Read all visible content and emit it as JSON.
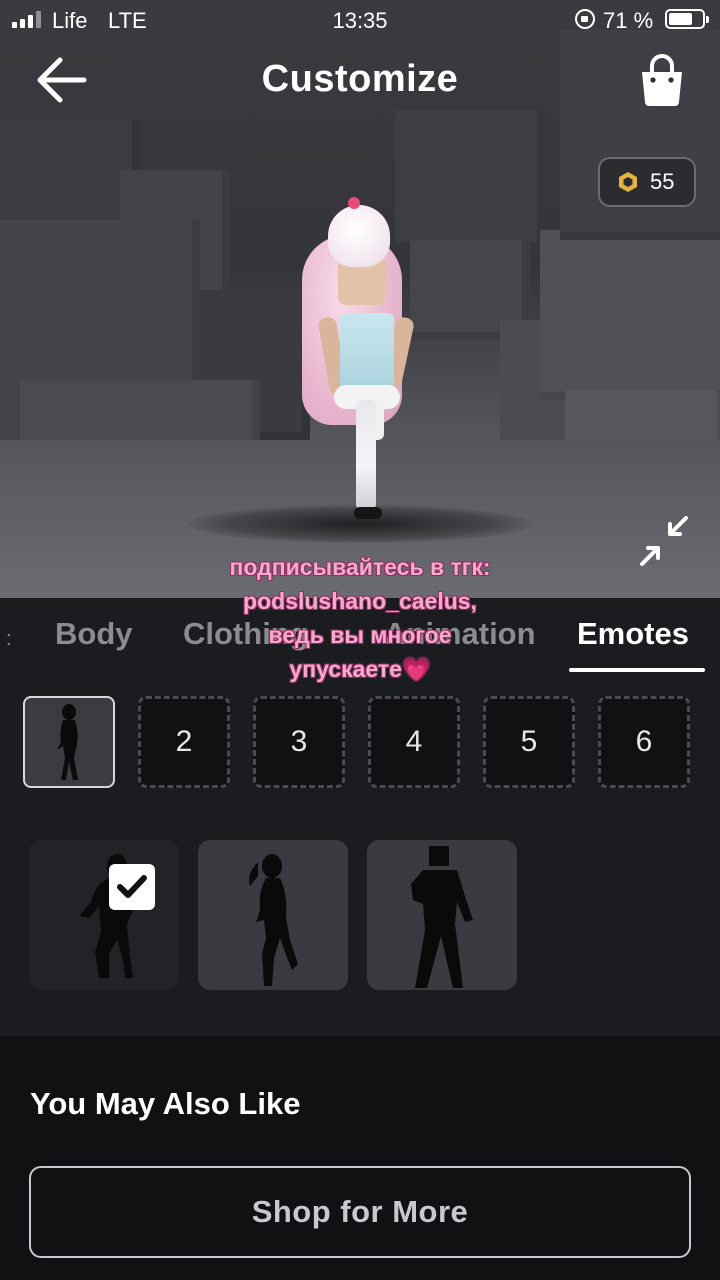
{
  "status_bar": {
    "carrier": "Life",
    "network": "LTE",
    "time": "13:35",
    "battery_percent_label": "71 %",
    "battery_level": 0.71
  },
  "header": {
    "title": "Customize",
    "back_icon": "arrow-left-icon",
    "shop_icon": "shopping-bag-icon"
  },
  "currency": {
    "icon": "robux-icon",
    "amount": "55"
  },
  "scene": {
    "expand_icon": "collapse-arrows-icon"
  },
  "overlay_caption": {
    "line1": "подписывайтесь в тгк:",
    "line2": "podslushano_caelus,",
    "line3": "ведь вы многое",
    "line4": "упускаете💗"
  },
  "tabs": [
    {
      "label": "Body",
      "active": false
    },
    {
      "label": "Clothing",
      "active": false
    },
    {
      "label": "Animation",
      "active": false
    },
    {
      "label": "Emotes",
      "active": true
    }
  ],
  "emote_slots": [
    {
      "label": "",
      "selected": true,
      "icon": "emote-silhouette-icon"
    },
    {
      "label": "2",
      "selected": false
    },
    {
      "label": "3",
      "selected": false
    },
    {
      "label": "4",
      "selected": false
    },
    {
      "label": "5",
      "selected": false
    },
    {
      "label": "6",
      "selected": false
    }
  ],
  "emote_cards": [
    {
      "icon": "emote-silhouette-icon",
      "equipped": true,
      "check_icon": "checkmark-icon"
    },
    {
      "icon": "emote-silhouette-icon",
      "equipped": false
    },
    {
      "icon": "emote-silhouette-icon",
      "equipped": false
    }
  ],
  "recommendations": {
    "heading": "You May Also Like",
    "shop_button": "Shop for More"
  },
  "colors": {
    "background": "#1b1c1f",
    "bottom_panel": "#101113",
    "caption_pink": "#f7a8cf",
    "inactive_tab": "#8b8c90"
  }
}
